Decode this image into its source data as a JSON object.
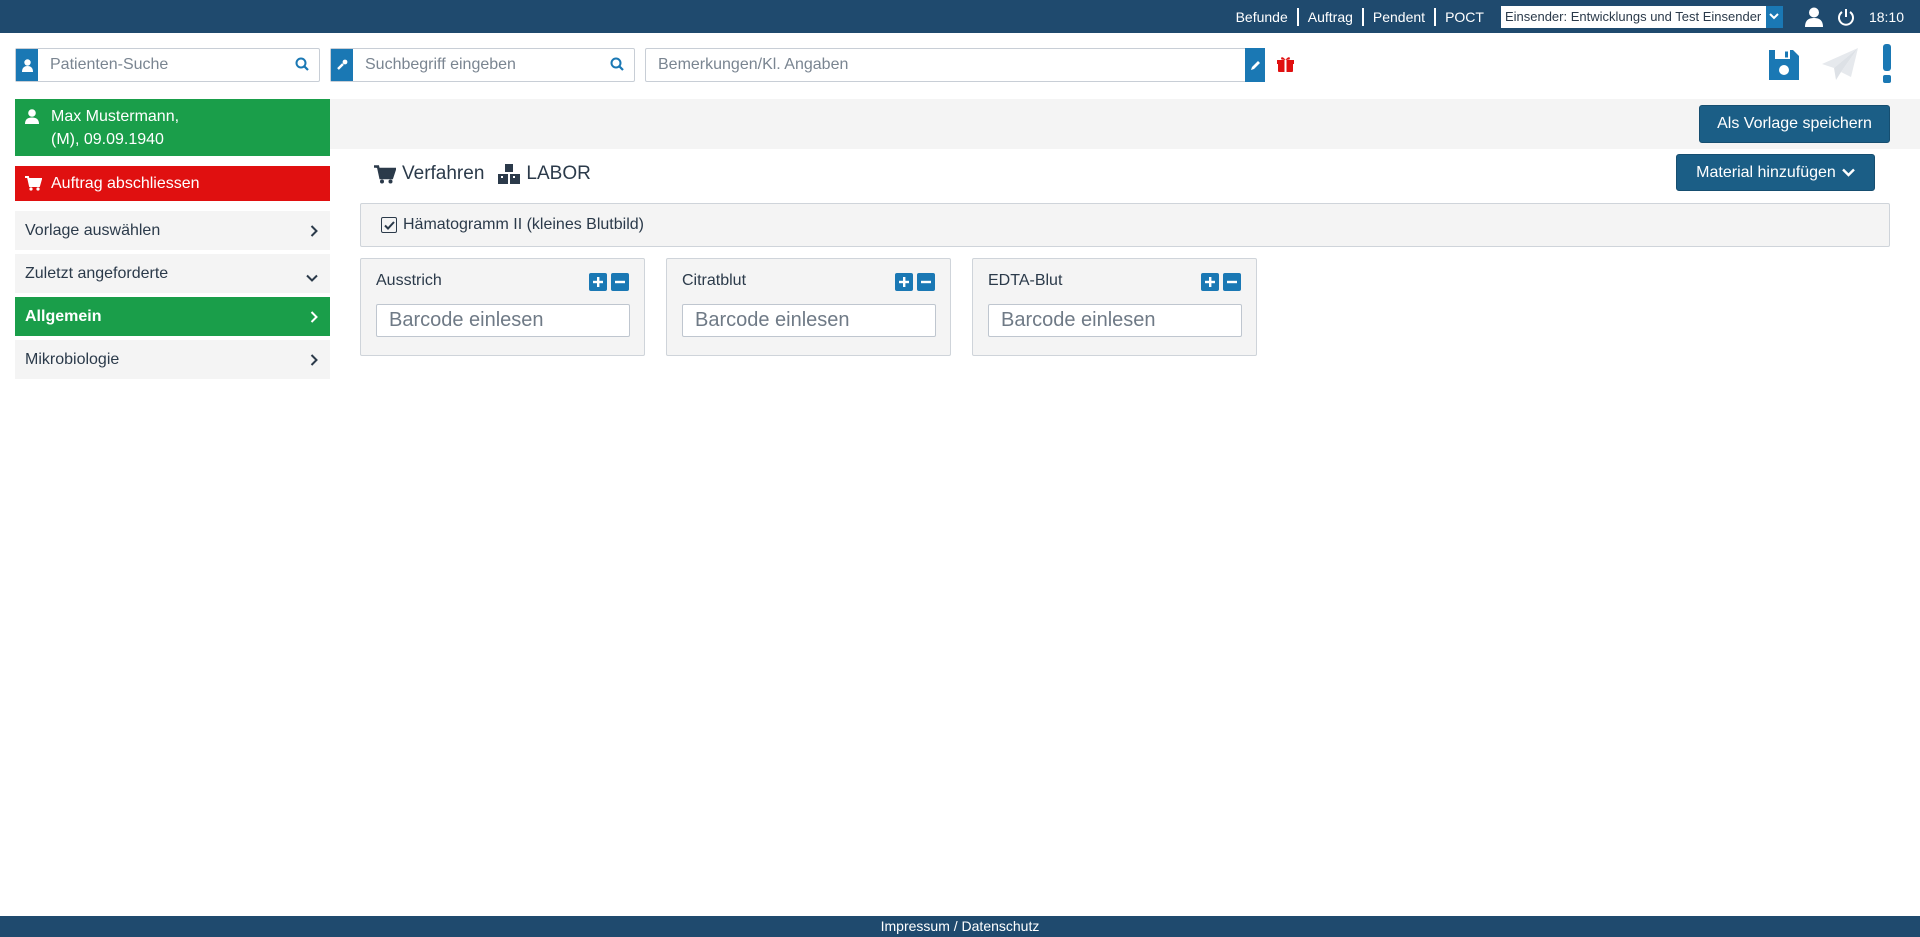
{
  "topbar": {
    "nav": [
      "Befunde",
      "Auftrag",
      "Pendent",
      "POCT"
    ],
    "sender": "Einsender: Entwicklungs und Test Einsender",
    "time": "18:10",
    "icons": [
      "user-icon",
      "power-icon"
    ]
  },
  "search": {
    "patient_placeholder": "Patienten-Suche",
    "term_placeholder": "Suchbegriff eingeben",
    "remarks_placeholder": "Bemerkungen/Kl. Angaben"
  },
  "actions": {
    "icons": [
      "save-icon",
      "send-icon",
      "exclamation-icon",
      "gift-icon"
    ]
  },
  "patient": {
    "line1": "Max Mustermann,",
    "line2": "(M), 09.09.1940"
  },
  "sidebar": {
    "finish_label": "Auftrag abschliessen",
    "items": [
      {
        "label": "Vorlage auswählen",
        "chevron": "right"
      },
      {
        "label": "Zuletzt angeforderte",
        "chevron": "down"
      },
      {
        "label": "Allgemein",
        "chevron": "right",
        "active": true
      },
      {
        "label": "Mikrobiologie",
        "chevron": "right"
      }
    ]
  },
  "main": {
    "save_template_label": "Als Vorlage speichern",
    "add_material_label": "Material hinzufügen",
    "crumb_procedure": "Verfahren",
    "crumb_lab": "LABOR",
    "procedure": "Hämatogramm II (kleines Blutbild)",
    "procedure_checked": true,
    "materials": [
      {
        "name": "Ausstrich",
        "barcode_placeholder": "Barcode einlesen"
      },
      {
        "name": "Citratblut",
        "barcode_placeholder": "Barcode einlesen"
      },
      {
        "name": "EDTA-Blut",
        "barcode_placeholder": "Barcode einlesen"
      }
    ]
  },
  "footer": {
    "text": "Impressum / Datenschutz"
  },
  "colors": {
    "topbar": "#1f4a6e",
    "accent_blue": "#1a78b4",
    "primary_button": "#1b5e86",
    "green": "#1a9e4a",
    "red": "#e01010"
  }
}
